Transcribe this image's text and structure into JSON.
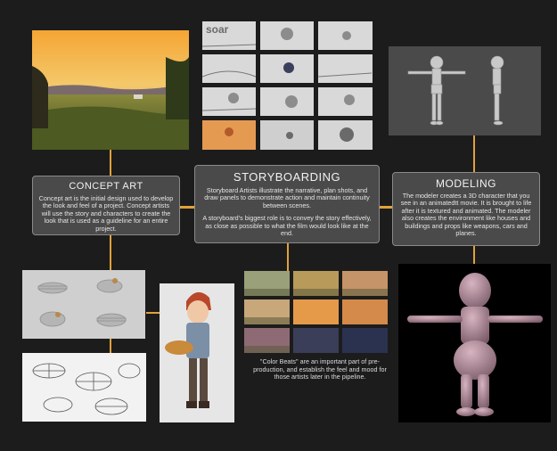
{
  "concept_art": {
    "title": "CONCEPT ART",
    "body": "Concept art is the initial design used to develop the look and feel of a project. Concept artists will use the story and characters to create the look that is used as a guideline for an entire project."
  },
  "storyboarding": {
    "title": "STORYBOARDING",
    "body_1": "Storyboard Artists illustrate the narrative, plan shots, and draw panels to demonstrate action and maintain continuity between  scenes.",
    "body_2": "A storyboard’s biggest role is to convey the story effectively, as close as possible to what the film would look like at the end.",
    "thumb_text": "soar"
  },
  "modeling": {
    "title": "MODELING",
    "body": "The modeler creates a 3D character that you see in an animatedtt movie.  It is brought to life after it is textured and animated.  The modeler also creates the environment like houses and buildings and props like weapons, cars and planes."
  },
  "color_beats": {
    "caption": "\"Color Beats\" are an important part of pre-production, and establish the feel and mood for those artists later in the pipeline."
  },
  "colors": {
    "accent_line": "#e0a23a",
    "panel_bg": "#4a4a4a",
    "page_bg": "#1c1c1c"
  }
}
